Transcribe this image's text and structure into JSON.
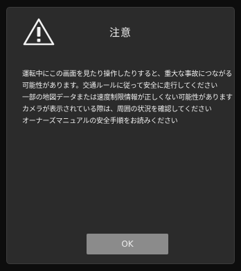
{
  "dialog": {
    "title": "注意",
    "icon": "warning-triangle-icon",
    "message_lines": [
      "運転中にこの画面を見たり操作したりすると、重大な事故につながる",
      "可能性があります。交通ルールに従って安全に走行してください",
      "一部の地図データまたは速度制限情報が正しくない可能性があります",
      "カメラが表示されている際は、周囲の状況を確認してください",
      "オーナーズマニュアルの安全手順をお読みください"
    ],
    "ok_label": "OK"
  },
  "colors": {
    "background": "#0d0d0d",
    "dialog": "#2b2b2b",
    "button": "#8b8b8b",
    "text": "#f0f0f0"
  }
}
